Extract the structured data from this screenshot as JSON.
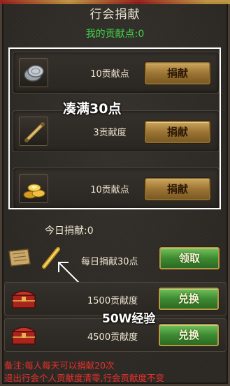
{
  "title": "行会捐献",
  "my_points": "我的贡献点:0",
  "overlay_fill_30": "凑满30点",
  "donate_rows": [
    {
      "label": "10贡献点",
      "button": "捐献",
      "icon": "silver-coins-icon"
    },
    {
      "label": "3贡献度",
      "button": "捐献",
      "icon": "scroll-icon"
    },
    {
      "label": "10贡献点",
      "button": "捐献",
      "icon": "gold-ingots-icon"
    }
  ],
  "today_donated": "今日捐献:0",
  "daily_reward": {
    "label": "每日捐献30点",
    "button": "领取"
  },
  "exchange_rows": [
    {
      "label": "1500贡献度",
      "button": "兑换",
      "icon": "treasure-chest-icon"
    },
    {
      "label": "4500贡献度",
      "button": "兑换",
      "icon": "treasure-chest-icon"
    }
  ],
  "overlay_50w": "50W经验",
  "notes": [
    "备注:每人每天可以捐献20次",
    "退出行会个人贡献度清零,行会贡献度不变"
  ],
  "colors": {
    "title": "#e8e1cf",
    "green_text": "#43d64a",
    "note": "#e8302a",
    "gold_button": "#9c7434",
    "green_button": "#3e8a32"
  }
}
